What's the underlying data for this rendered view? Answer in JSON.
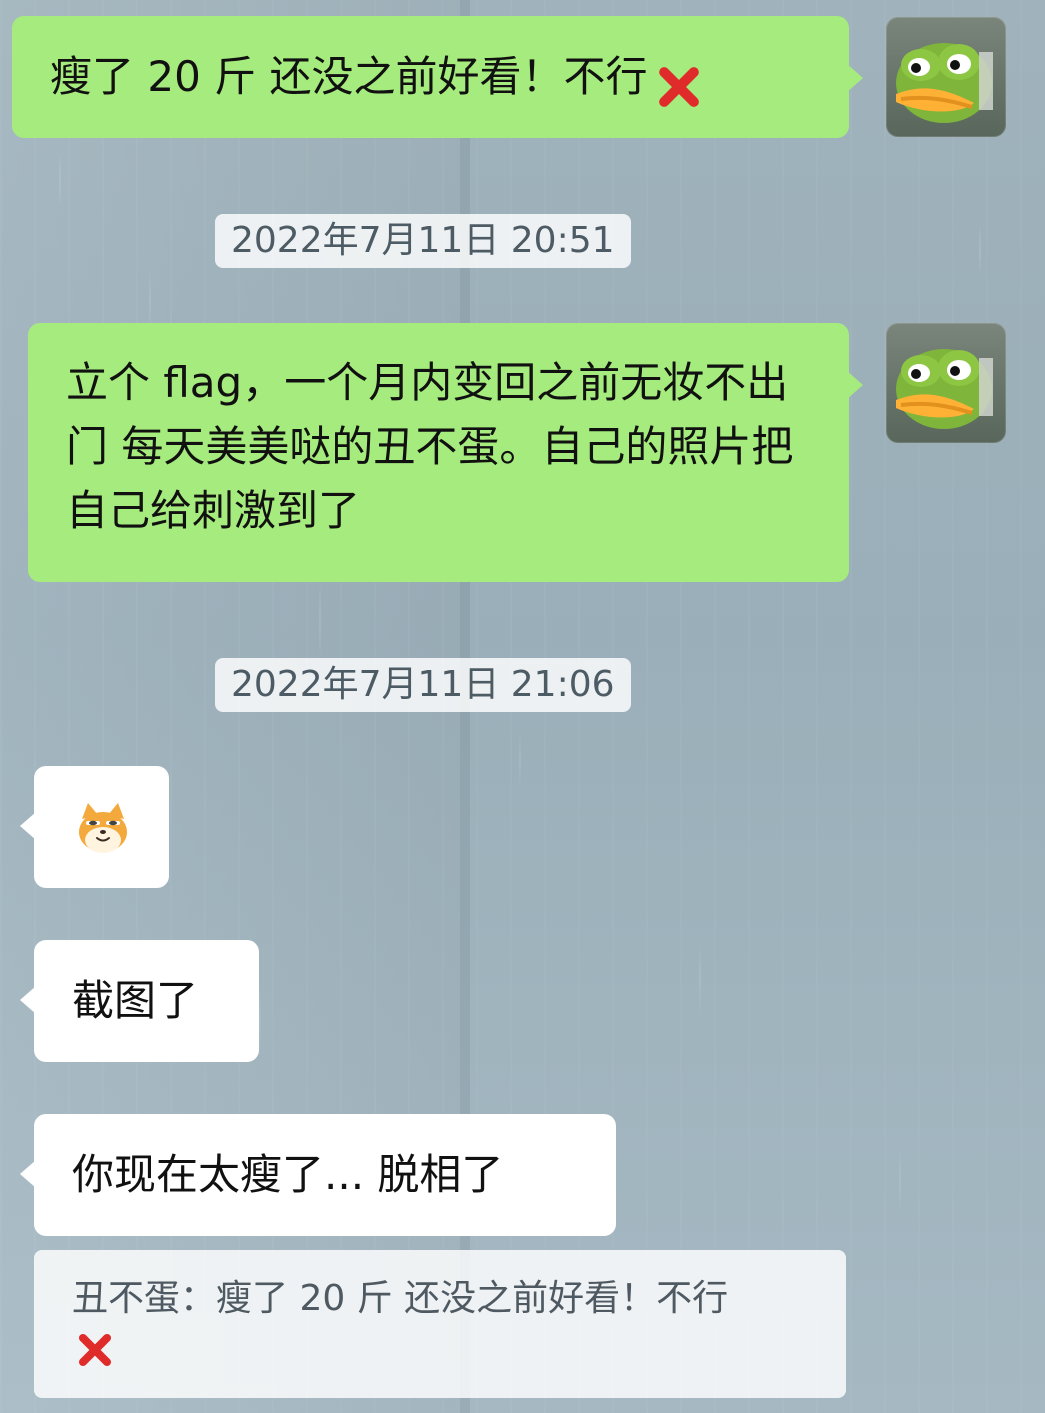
{
  "messages": [
    {
      "text": "瘦了 20 斤 还没之前好看！不行"
    },
    {
      "timestamp": "2022年7月11日 20:51"
    },
    {
      "text": "立个 flag，一个月内变回之前无妆不出门 每天美美哒的丑不蛋。自己的照片把自己给刺激到了"
    },
    {
      "timestamp": "2022年7月11日 21:06"
    },
    {
      "text": "截图了"
    },
    {
      "text": "你现在太瘦了... 脱相了"
    },
    {
      "quote": "丑不蛋：瘦了 20 斤 还没之前好看！不行"
    }
  ],
  "icons": {
    "x": "red-cross-icon",
    "frog": "frog-avatar",
    "cat": "cat-emoji-icon"
  },
  "colors": {
    "green_bubble": "#a6eb7d",
    "white_bubble": "#ffffff",
    "timestamp_text": "#4d5b65"
  }
}
